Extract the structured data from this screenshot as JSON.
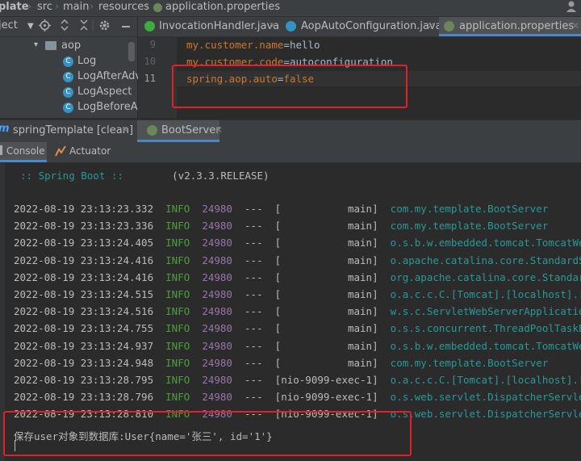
{
  "breadcrumb": [
    "plate",
    "src",
    "main",
    "resources",
    "application.properties"
  ],
  "project_header": {
    "label": "ject"
  },
  "tabs": [
    {
      "label": "InvocationHandler.java",
      "icon_color": "#3dae3d",
      "active": false
    },
    {
      "label": "AopAutoConfiguration.java",
      "icon_color": "#3592c4",
      "active": false
    },
    {
      "label": "application.properties",
      "icon_color": "#6a8759",
      "active": true
    }
  ],
  "tree": {
    "folder": "aop",
    "items": [
      "Log",
      "LogAfterAdvi",
      "LogAspect",
      "LogBeforeAd"
    ]
  },
  "editor": {
    "lines": [
      {
        "num": "9",
        "key": "my.customer.name",
        "value": "hello"
      },
      {
        "num": "10",
        "key": "my.customer.code",
        "value": "autoconfiguration"
      },
      {
        "num": "11",
        "key": "spring.aop.auto",
        "value": "false"
      }
    ]
  },
  "run_tabs": [
    {
      "label": "springTemplate [clean]",
      "active": false
    },
    {
      "label": "BootServer",
      "active": true
    }
  ],
  "console_tabs": [
    "Console",
    "Actuator"
  ],
  "console": {
    "banner": {
      "name": ":: Spring Boot ::",
      "version": "(v2.3.3.RELEASE)"
    },
    "logs": [
      {
        "ts": "2022-08-19 23:13:23.332",
        "level": "INFO",
        "pid": "24980",
        "sep": "---",
        "thread": "[           main]",
        "logger": "com.my.template.BootServer"
      },
      {
        "ts": "2022-08-19 23:13:23.336",
        "level": "INFO",
        "pid": "24980",
        "sep": "---",
        "thread": "[           main]",
        "logger": "com.my.template.BootServer"
      },
      {
        "ts": "2022-08-19 23:13:24.405",
        "level": "INFO",
        "pid": "24980",
        "sep": "---",
        "thread": "[           main]",
        "logger": "o.s.b.w.embedded.tomcat.TomcatWeb"
      },
      {
        "ts": "2022-08-19 23:13:24.416",
        "level": "INFO",
        "pid": "24980",
        "sep": "---",
        "thread": "[           main]",
        "logger": "o.apache.catalina.core.StandardSe"
      },
      {
        "ts": "2022-08-19 23:13:24.416",
        "level": "INFO",
        "pid": "24980",
        "sep": "---",
        "thread": "[           main]",
        "logger": "org.apache.catalina.core.Standard"
      },
      {
        "ts": "2022-08-19 23:13:24.515",
        "level": "INFO",
        "pid": "24980",
        "sep": "---",
        "thread": "[           main]",
        "logger": "o.a.c.c.C.[Tomcat].[localhost].[/"
      },
      {
        "ts": "2022-08-19 23:13:24.516",
        "level": "INFO",
        "pid": "24980",
        "sep": "---",
        "thread": "[           main]",
        "logger": "w.s.c.ServletWebServerApplication"
      },
      {
        "ts": "2022-08-19 23:13:24.755",
        "level": "INFO",
        "pid": "24980",
        "sep": "---",
        "thread": "[           main]",
        "logger": "o.s.s.concurrent.ThreadPoolTaskExe"
      },
      {
        "ts": "2022-08-19 23:13:24.937",
        "level": "INFO",
        "pid": "24980",
        "sep": "---",
        "thread": "[           main]",
        "logger": "o.s.b.w.embedded.tomcat.TomcatWeb"
      },
      {
        "ts": "2022-08-19 23:13:24.948",
        "level": "INFO",
        "pid": "24980",
        "sep": "---",
        "thread": "[           main]",
        "logger": "com.my.template.BootServer"
      },
      {
        "ts": "2022-08-19 23:13:28.795",
        "level": "INFO",
        "pid": "24980",
        "sep": "---",
        "thread": "[nio-9099-exec-1]",
        "logger": "o.a.c.c.C.[Tomcat].[localhost].[/"
      },
      {
        "ts": "2022-08-19 23:13:28.796",
        "level": "INFO",
        "pid": "24980",
        "sep": "---",
        "thread": "[nio-9099-exec-1]",
        "logger": "o.s.web.servlet.DispatcherServlet"
      },
      {
        "ts": "2022-08-19 23:13:28.810",
        "level": "INFO",
        "pid": "24980",
        "sep": "---",
        "thread": "[nio-9099-exec-1]",
        "logger": "o.s.web.servlet.DispatcherServlet"
      }
    ],
    "output": "保存user对象到数据库:User{name='张三', id='1'}"
  },
  "colors": {
    "highlight_box": "#e0202a",
    "info": "#4e9e3e",
    "pid": "#9876aa",
    "logger": "#299999",
    "property_key": "#cc7832",
    "property_value": "#6a8759"
  }
}
